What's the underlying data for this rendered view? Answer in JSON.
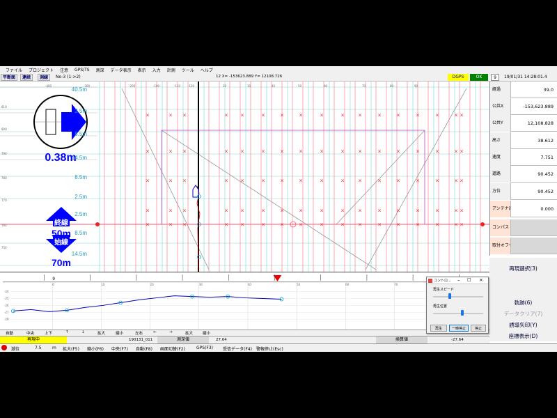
{
  "menu": [
    "ファイル",
    "プロジェクト",
    "注意",
    "GPS/TS",
    "測深",
    "データ表示",
    "表示",
    "入力",
    "計測",
    "ツール",
    "ヘルプ"
  ],
  "toolbar": {
    "btn_plan": "平断面",
    "btn_continuous": "連続",
    "btn_survey": "測線",
    "line_label": "No-3 (1->2)",
    "coords": "12 X= -153623.889 Y= 12108.726",
    "dgps": "DGPS",
    "ok": "OK",
    "counter": "9",
    "datetime": "19/01/31 14:28:01.4"
  },
  "plan": {
    "distance_readout": "0.38m",
    "end_line_label": "終線",
    "end_line_value": "50m",
    "start_line_label": "始線",
    "start_line_value": "70m",
    "offsets": [
      "40.5m",
      "2.5m",
      "8.5m",
      "14.5m",
      "8.5m",
      "2.5m",
      "2.5m",
      "8.5m",
      "14.5m"
    ],
    "top_ticks": [
      "-400",
      "-300",
      "-200",
      "-100",
      "-110",
      "-120",
      "20",
      "30",
      "40",
      "50",
      "60",
      "70",
      "80",
      "90"
    ],
    "left_ticks": [
      "810",
      "800",
      "790",
      "780",
      "770",
      "760",
      "750"
    ]
  },
  "info_panel": {
    "rows": [
      {
        "label": "経過",
        "value": "39.0"
      },
      {
        "label": "公共X",
        "value": "-153,623.889"
      },
      {
        "label": "公共Y",
        "value": "12,108.828"
      },
      {
        "label": "高さ",
        "value": "38.612"
      },
      {
        "label": "速度",
        "value": "7.751"
      },
      {
        "label": "進路",
        "value": "90.452"
      },
      {
        "label": "方位",
        "value": "90.452"
      },
      {
        "label": "アンテナ高",
        "value": "0.000"
      },
      {
        "label": "コンパス",
        "value": ""
      },
      {
        "label": "取付オフセット",
        "value": ""
      }
    ],
    "buttons": [
      "再現選択(3)",
      "軌跡(6)",
      "データクリア(7)",
      "誘導矢印(Y)",
      "座標表示(D)"
    ]
  },
  "profile": {
    "y_ticks": [
      "-24",
      "-25",
      "-26",
      "-27",
      "-28"
    ],
    "x_ticks": [
      "0",
      "10",
      "20",
      "30",
      "40",
      "50",
      "60",
      "70"
    ],
    "depth_series": [
      -26.8,
      -26.6,
      -26.9,
      -26.7,
      -26.3,
      -26.0,
      -25.6,
      -25.2,
      -24.9,
      -24.6,
      -24.7,
      -24.8,
      -24.7,
      -24.9,
      -25.0,
      -25.1
    ],
    "status_marker": "9"
  },
  "profile_controls": {
    "labels": [
      "自動",
      "中央",
      "上下",
      "↑",
      "↓",
      "拡大",
      "縮小",
      "左右",
      "←",
      "→",
      "拡大",
      "縮小"
    ]
  },
  "status_bar": {
    "replaying": "再現中",
    "timestamp": "190131_011",
    "depth_label": "測深値",
    "depth_value": "27.64",
    "corrected_label": "換算値",
    "corrected_value": "-27.64"
  },
  "function_keys": [
    "潮位",
    "7.5",
    "m",
    "拡大(F5)",
    "縮小(F6)",
    "中央(F7)",
    "自動(F8)",
    "画面切替(F2)",
    "GPS(F3)",
    "受信データ(F4)",
    "警報停止(Esc)"
  ],
  "dialog": {
    "title": "コントロ...",
    "speed_label": "再生スピード",
    "position_label": "再生位置",
    "btn_play": "再生",
    "btn_pause": "一時停止",
    "btn_stop": "停止"
  },
  "colors": {
    "arrow_blue": "#0000ff",
    "grid_pink": "#ff6680",
    "grid_cyan": "#66cccc",
    "track_blue": "#0000aa",
    "marker_red": "#ee2222"
  }
}
